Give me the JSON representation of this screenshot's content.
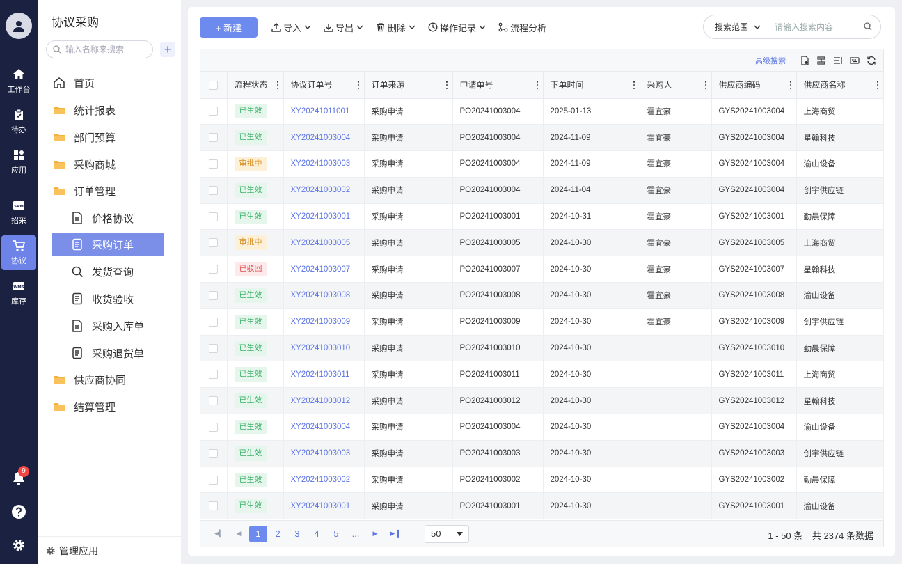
{
  "rail": {
    "items": [
      {
        "label": "工作台",
        "icon": "home-icon"
      },
      {
        "label": "待办",
        "icon": "clipboard-icon"
      },
      {
        "label": "应用",
        "icon": "apps-icon"
      },
      {
        "label": "招采",
        "icon": "srm-icon"
      },
      {
        "label": "协议",
        "icon": "cart-icon"
      },
      {
        "label": "库存",
        "icon": "wms-icon"
      }
    ],
    "srm_text": "SRM",
    "wms_text": "WMS",
    "notifications": "9"
  },
  "side": {
    "title": "协议采购",
    "search_placeholder": "输入名称来搜索",
    "add": "+",
    "nav": [
      {
        "label": "首页",
        "icon": "home-outline-icon"
      },
      {
        "label": "统计报表",
        "icon": "folder-icon"
      },
      {
        "label": "部门预算",
        "icon": "folder-icon"
      },
      {
        "label": "采购商城",
        "icon": "folder-icon"
      },
      {
        "label": "订单管理",
        "icon": "folder-icon"
      },
      {
        "label": "价格协议",
        "icon": "document-icon"
      },
      {
        "label": "采购订单",
        "icon": "list-doc-icon"
      },
      {
        "label": "发货查询",
        "icon": "search-icon"
      },
      {
        "label": "收货验收",
        "icon": "list-doc-icon"
      },
      {
        "label": "采购入库单",
        "icon": "document-icon"
      },
      {
        "label": "采购退货单",
        "icon": "list-doc-icon"
      },
      {
        "label": "供应商协同",
        "icon": "folder-icon"
      },
      {
        "label": "结算管理",
        "icon": "folder-icon"
      }
    ],
    "footer": "管理应用"
  },
  "toolbar": {
    "new": "+ 新建",
    "import": "导入",
    "export": "导出",
    "delete": "删除",
    "log": "操作记录",
    "flow": "流程分析",
    "scope": "搜索范围",
    "search_placeholder": "请输入搜索内容"
  },
  "grid": {
    "advanced": "高级搜索",
    "columns": [
      "流程状态",
      "协议订单号",
      "订单来源",
      "申请单号",
      "下单时间",
      "采购人",
      "供应商编码",
      "供应商名称"
    ],
    "rows": [
      {
        "status": "已生效",
        "st": "ok",
        "no": "XY20241011001",
        "src": "采购申请",
        "req": "PO20241003004",
        "date": "2025-01-13",
        "buyer": "霍宜豪",
        "code": "GYS20241003004",
        "name": "上海商贸"
      },
      {
        "status": "已生效",
        "st": "ok",
        "no": "XY20241003004",
        "src": "采购申请",
        "req": "PO20241003004",
        "date": "2024-11-09",
        "buyer": "霍宜豪",
        "code": "GYS20241003004",
        "name": "星翰科技"
      },
      {
        "status": "审批中",
        "st": "wait",
        "no": "XY20241003003",
        "src": "采购申请",
        "req": "PO20241003004",
        "date": "2024-11-09",
        "buyer": "霍宜豪",
        "code": "GYS20241003004",
        "name": "渝山设备"
      },
      {
        "status": "已生效",
        "st": "ok",
        "no": "XY20241003002",
        "src": "采购申请",
        "req": "PO20241003004",
        "date": "2024-11-04",
        "buyer": "霍宜豪",
        "code": "GYS20241003004",
        "name": "创宇供应链"
      },
      {
        "status": "已生效",
        "st": "ok",
        "no": "XY20241003001",
        "src": "采购申请",
        "req": "PO20241003001",
        "date": "2024-10-31",
        "buyer": "霍宜豪",
        "code": "GYS20241003001",
        "name": "勤晨保障"
      },
      {
        "status": "审批中",
        "st": "wait",
        "no": "XY20241003005",
        "src": "采购申请",
        "req": "PO20241003005",
        "date": "2024-10-30",
        "buyer": "霍宜豪",
        "code": "GYS20241003005",
        "name": "上海商贸"
      },
      {
        "status": "已驳回",
        "st": "rej",
        "no": "XY20241003007",
        "src": "采购申请",
        "req": "PO20241003007",
        "date": "2024-10-30",
        "buyer": "霍宜豪",
        "code": "GYS20241003007",
        "name": "星翰科技"
      },
      {
        "status": "已生效",
        "st": "ok",
        "no": "XY20241003008",
        "src": "采购申请",
        "req": "PO20241003008",
        "date": "2024-10-30",
        "buyer": "霍宜豪",
        "code": "GYS20241003008",
        "name": "渝山设备"
      },
      {
        "status": "已生效",
        "st": "ok",
        "no": "XY20241003009",
        "src": "采购申请",
        "req": "PO20241003009",
        "date": "2024-10-30",
        "buyer": "霍宜豪",
        "code": "GYS20241003009",
        "name": "创宇供应链"
      },
      {
        "status": "已生效",
        "st": "ok",
        "no": "XY20241003010",
        "src": "采购申请",
        "req": "PO20241003010",
        "date": "2024-10-30",
        "buyer": "",
        "code": "GYS20241003010",
        "name": "勤晨保障"
      },
      {
        "status": "已生效",
        "st": "ok",
        "no": "XY20241003011",
        "src": "采购申请",
        "req": "PO20241003011",
        "date": "2024-10-30",
        "buyer": "",
        "code": "GYS20241003011",
        "name": "上海商贸"
      },
      {
        "status": "已生效",
        "st": "ok",
        "no": "XY20241003012",
        "src": "采购申请",
        "req": "PO20241003012",
        "date": "2024-10-30",
        "buyer": "",
        "code": "GYS20241003012",
        "name": "星翰科技"
      },
      {
        "status": "已生效",
        "st": "ok",
        "no": "XY20241003004",
        "src": "采购申请",
        "req": "PO20241003004",
        "date": "2024-10-30",
        "buyer": "",
        "code": "GYS20241003004",
        "name": "渝山设备"
      },
      {
        "status": "已生效",
        "st": "ok",
        "no": "XY20241003003",
        "src": "采购申请",
        "req": "PO20241003003",
        "date": "2024-10-30",
        "buyer": "",
        "code": "GYS20241003003",
        "name": "创宇供应链"
      },
      {
        "status": "已生效",
        "st": "ok",
        "no": "XY20241003002",
        "src": "采购申请",
        "req": "PO20241003002",
        "date": "2024-10-30",
        "buyer": "",
        "code": "GYS20241003002",
        "name": "勤晨保障"
      },
      {
        "status": "已生效",
        "st": "ok",
        "no": "XY20241003001",
        "src": "采购申请",
        "req": "PO20241003001",
        "date": "2024-10-30",
        "buyer": "",
        "code": "GYS20241003001",
        "name": "渝山设备"
      }
    ]
  },
  "pager": {
    "pages": [
      "1",
      "2",
      "3",
      "4",
      "5",
      "..."
    ],
    "current": "1",
    "page_size": "50",
    "range": "1 - 50 条",
    "total": "共 2374 条数据"
  },
  "colors": {
    "rail_bg": "#1b2140",
    "accent": "#6d8bef",
    "ok": "#3bb26b",
    "wait": "#d58c1e",
    "reject": "#e05050"
  }
}
